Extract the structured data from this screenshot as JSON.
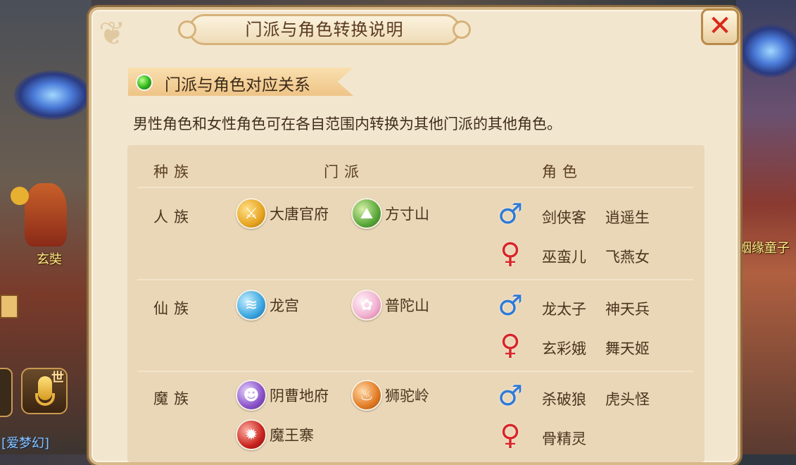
{
  "background": {
    "npc_name": "玄奘",
    "npc_name_right": "姻缘童子",
    "world_channel": "世",
    "chat_tag": "[爱梦幻]"
  },
  "dialog": {
    "title": "门派与角色转换说明",
    "section_title": "门派与角色对应关系",
    "description": "男性角色和女性角色可在各自范围内转换为其他门派的其他角色。",
    "close_symbol": "✕",
    "headers": {
      "race": "种族",
      "sect": "门派",
      "role": "角色"
    },
    "rows": [
      {
        "race": "人族",
        "sects": [
          {
            "name": "大唐官府",
            "icon": "sword-icon",
            "color": "#e7a521"
          },
          {
            "name": "方寸山",
            "icon": "mountain-icon",
            "color": "#5aa83a"
          }
        ],
        "male_roles": [
          "剑侠客",
          "逍遥生"
        ],
        "female_roles": [
          "巫蛮儿",
          "飞燕女"
        ]
      },
      {
        "race": "仙族",
        "sects": [
          {
            "name": "龙宫",
            "icon": "wave-icon",
            "color": "#3aa6e0"
          },
          {
            "name": "普陀山",
            "icon": "lotus-icon",
            "color": "#e883b8"
          }
        ],
        "male_roles": [
          "龙太子",
          "神天兵"
        ],
        "female_roles": [
          "玄彩娥",
          "舞天姬"
        ]
      },
      {
        "race": "魔族",
        "sects": [
          {
            "name": "阴曹地府",
            "icon": "skull-icon",
            "color": "#8a52c9"
          },
          {
            "name": "狮驼岭",
            "icon": "flame-icon",
            "color": "#e27b24"
          },
          {
            "name": "魔王寨",
            "icon": "demon-icon",
            "color": "#c9231e"
          }
        ],
        "male_roles": [
          "杀破狼",
          "虎头怪"
        ],
        "female_roles": [
          "骨精灵"
        ]
      }
    ],
    "colors": {
      "male": "#2f7ad6",
      "female": "#d82626",
      "section_dot": "#2fb51a",
      "close": "#d8281a"
    }
  }
}
